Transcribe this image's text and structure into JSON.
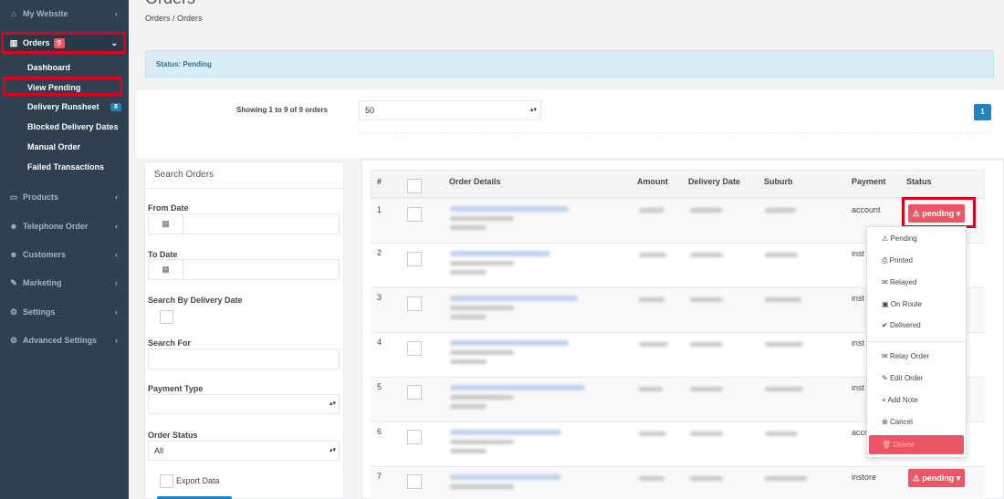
{
  "sidebar": {
    "my_website": "My Website",
    "orders": "Orders",
    "orders_badge": "9",
    "sub": {
      "dashboard": "Dashboard",
      "view_pending": "View Pending",
      "delivery_runsheet": "Delivery Runsheet",
      "runsheet_badge": "8",
      "blocked_dates": "Blocked Delivery Dates",
      "manual_order": "Manual Order",
      "failed_transactions": "Failed Transactions"
    },
    "products": "Products",
    "telephone_order": "Telephone Order",
    "customers": "Customers",
    "marketing": "Marketing",
    "settings": "Settings",
    "advanced_settings": "Advanced Settings"
  },
  "header": {
    "title": "Orders",
    "breadcrumb": "Orders / Orders"
  },
  "status_box": "Status: Pending",
  "listing": {
    "showing": "Showing 1 to 9 of 9 orders",
    "per_page": "50",
    "page": "1"
  },
  "search": {
    "title": "Search Orders",
    "from_date": "From Date",
    "to_date": "To Date",
    "by_delivery_date": "Search By Delivery Date",
    "search_for": "Search For",
    "payment_type": "Payment Type",
    "order_status": "Order Status",
    "order_status_value": "All",
    "export": "Export Data"
  },
  "table": {
    "headers": {
      "num": "#",
      "details": "Order Details",
      "amount": "Amount",
      "delivery": "Delivery Date",
      "suburb": "Suburb",
      "payment": "Payment",
      "status": "Status"
    },
    "rows": [
      {
        "num": "1",
        "payment": "account"
      },
      {
        "num": "2",
        "payment": "inst"
      },
      {
        "num": "3",
        "payment": "inst"
      },
      {
        "num": "4",
        "payment": "inst"
      },
      {
        "num": "5",
        "payment": "inst"
      },
      {
        "num": "6",
        "payment": "acco"
      },
      {
        "num": "7",
        "payment": "instore"
      }
    ],
    "status_label": "pending"
  },
  "dropdown": {
    "pending": "Pending",
    "printed": "Printed",
    "relayed": "Relayed",
    "on_route": "On Route",
    "delivered": "Delivered",
    "relay_order": "Relay Order",
    "edit_order": "Edit Order",
    "add_note": "Add Note",
    "cancel": "Cancel",
    "delete": "Delete"
  },
  "colors": {
    "sidebar": "#2f4050",
    "danger": "#ed5565",
    "primary": "#1c84c6",
    "highlight": "#e0001b"
  }
}
